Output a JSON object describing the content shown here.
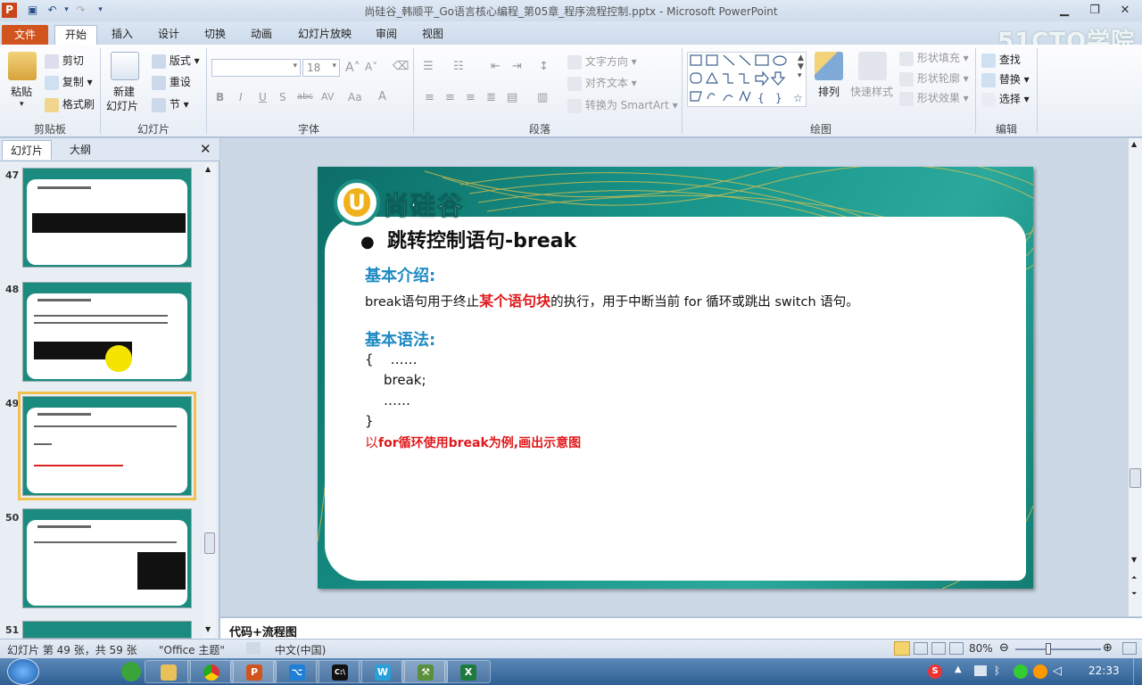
{
  "window": {
    "title": "尚硅谷_韩顺平_Go语言核心编程_第05章_程序流程控制.pptx - Microsoft PowerPoint"
  },
  "tabs": [
    "文件",
    "开始",
    "插入",
    "设计",
    "切换",
    "动画",
    "幻灯片放映",
    "审阅",
    "视图"
  ],
  "watermark": "51CTO学院",
  "ribbon": {
    "clipboard": {
      "label": "剪贴板",
      "paste": "粘贴",
      "cut": "剪切",
      "copy": "复制",
      "format_painter": "格式刷"
    },
    "slides": {
      "label": "幻灯片",
      "new_slide": "新建",
      "new_slide2": "幻灯片",
      "layout": "版式",
      "reset": "重设",
      "section": "节"
    },
    "font": {
      "label": "字体",
      "size": "18",
      "bold": "B",
      "italic": "I",
      "underline": "U",
      "shadow": "S",
      "strike": "abc",
      "spacing": "AV",
      "case": "Aa"
    },
    "paragraph": {
      "label": "段落",
      "text_direction": "文字方向",
      "align_text": "对齐文本",
      "smartart": "转换为 SmartArt"
    },
    "drawing": {
      "label": "绘图",
      "arrange": "排列",
      "quick_styles": "快速样式",
      "shape_fill": "形状填充",
      "shape_outline": "形状轮廓",
      "shape_effects": "形状效果"
    },
    "editing": {
      "label": "编辑",
      "find": "查找",
      "replace": "替换",
      "select": "选择"
    }
  },
  "pane": {
    "tab_slides": "幻灯片",
    "tab_outline": "大纲"
  },
  "thumbs": [
    {
      "num": "47"
    },
    {
      "num": "48"
    },
    {
      "num": "49"
    },
    {
      "num": "50"
    },
    {
      "num": "51"
    }
  ],
  "slide": {
    "logo": "尚硅谷",
    "title": "跳转控制语句-break",
    "intro_heading": "基本介绍:",
    "intro_pre": "break语句用于终止",
    "intro_highlight": "某个语句块",
    "intro_post": "的执行，用于中断当前 for 循环或跳出 switch 语句。",
    "syntax_heading": "基本语法:",
    "code": [
      "{    ……",
      "break;",
      "……",
      "}"
    ],
    "footer_pre": "以",
    "footer_bold": "for循环使用break为例,画出示意图"
  },
  "notes": "代码+流程图",
  "status": {
    "slide_info": "幻灯片 第 49 张，共 59 张",
    "theme": "\"Office 主题\"",
    "language": "中文(中国)",
    "zoom": "80%"
  },
  "clock": "22:33",
  "colors": {
    "accent_file": "#d1541e",
    "slide_green": "#18958a",
    "heading_blue": "#1f8bc3",
    "highlight_red": "#e0191c"
  }
}
